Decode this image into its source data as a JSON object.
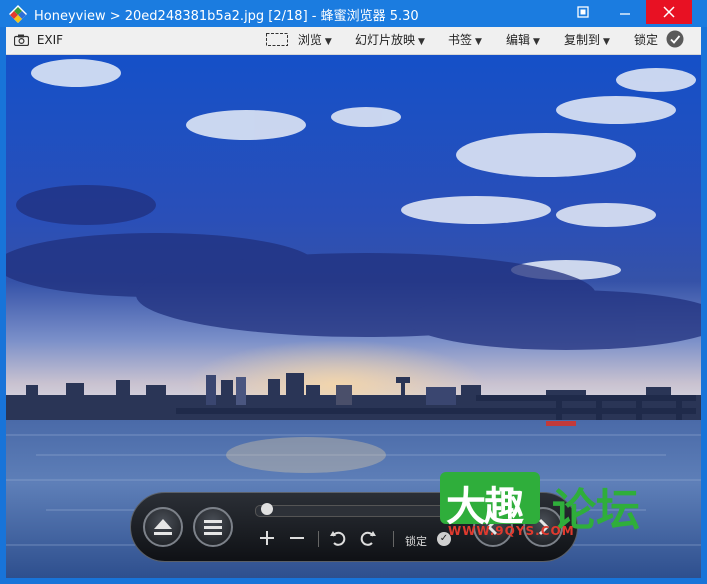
{
  "window": {
    "title": "Honeyview > 20ed248381b5a2.jpg [2/18] - 蜂蜜浏览器 5.30",
    "accent_color": "#1b7ce0",
    "close_color": "#e81123",
    "buttons": {
      "fullscreen": "fullscreen-icon",
      "minimize": "minimize-icon",
      "maximize": "maximize-icon",
      "close": "close-icon"
    }
  },
  "toolbar": {
    "exif_label": "EXIF",
    "browse_label": "浏览",
    "slideshow_label": "幻灯片放映",
    "bookmarks_label": "书签",
    "edit_label": "编辑",
    "copy_to_label": "复制到",
    "lock_label": "锁定"
  },
  "viewer": {
    "image_description_icon": "landscape-photo"
  },
  "controls": {
    "lock_label": "锁定",
    "icons": [
      "eject-icon",
      "menu-icon",
      "zoom-in-icon",
      "zoom-out-icon",
      "rotate-left-icon",
      "rotate-right-icon",
      "check-icon",
      "prev-icon",
      "next-icon"
    ]
  },
  "watermark": {
    "main_text": "大趣",
    "forum_text": "论坛",
    "url_text": "WWW.9QYS.COM"
  }
}
